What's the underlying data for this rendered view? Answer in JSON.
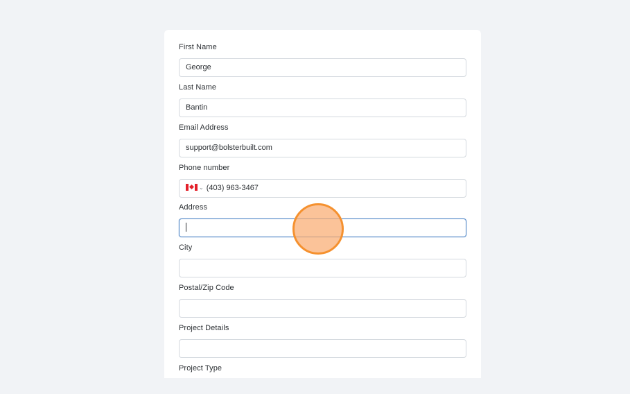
{
  "form": {
    "fields": [
      {
        "label": "First Name",
        "value": "George"
      },
      {
        "label": "Last Name",
        "value": "Bantin"
      },
      {
        "label": "Email Address",
        "value": "support@bolsterbuilt.com"
      },
      {
        "label": "Phone number",
        "value": "(403) 963-3467",
        "country_flag": "canada-flag-icon"
      },
      {
        "label": "Address",
        "value": "",
        "focused": true
      },
      {
        "label": "City",
        "value": ""
      },
      {
        "label": "Postal/Zip Code",
        "value": ""
      },
      {
        "label": "Project Details",
        "value": ""
      },
      {
        "label": "Project Type",
        "value": ""
      }
    ]
  },
  "colors": {
    "background": "#f1f3f6",
    "card": "#ffffff",
    "focus_border": "#4f86c6",
    "click_indicator": "#f5912f"
  }
}
